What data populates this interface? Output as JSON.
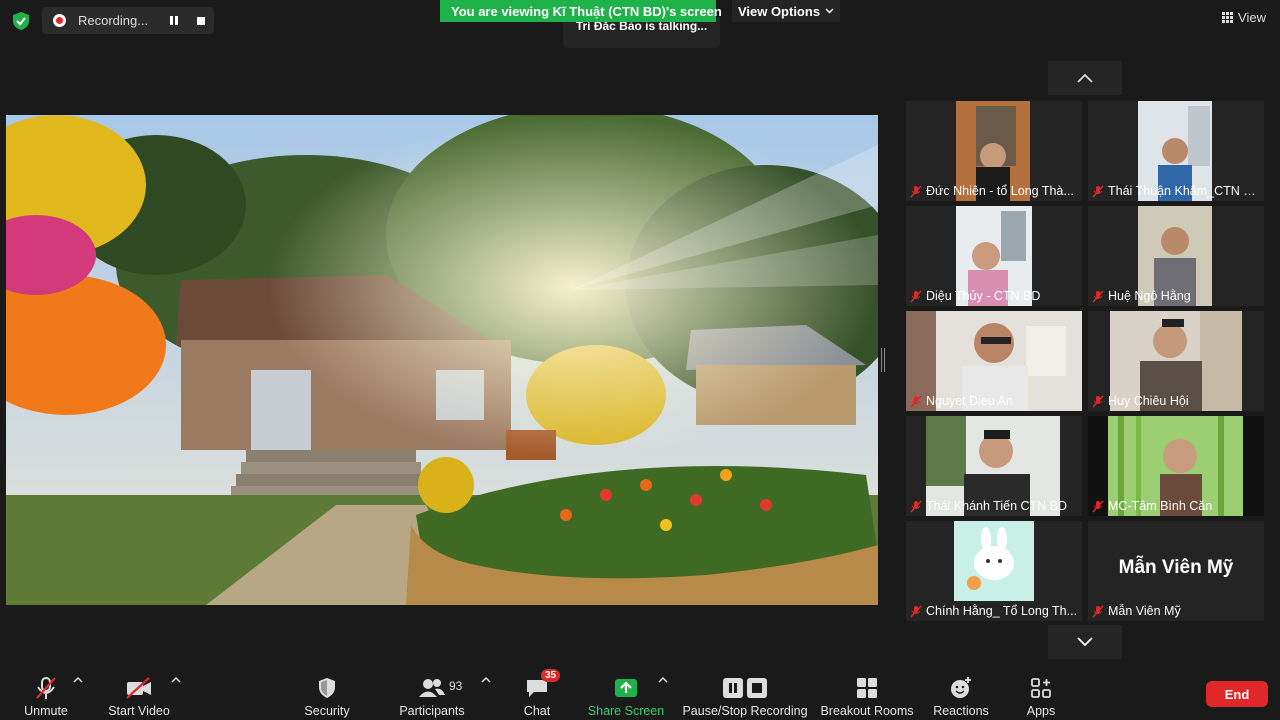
{
  "top": {
    "recording_label": "Recording...",
    "viewing_banner": "You are viewing Kĩ Thuật (CTN BD)'s screen",
    "view_options": "View Options",
    "talking": "Trí Đắc Bảo is talking...",
    "view_label": "View"
  },
  "gallery": {
    "tiles": [
      {
        "name": "Đức Nhiên - tổ Long Thà..."
      },
      {
        "name": "Thái Thuận Khâm_CTN Bỉ..."
      },
      {
        "name": "Diệu Thủy - CTN BD"
      },
      {
        "name": "Huệ Ngô Hằng"
      },
      {
        "name": "Nguyet Dieu An"
      },
      {
        "name": "Huy Chiêu Hội"
      },
      {
        "name": "Thái Khánh Tiến CTN BD"
      },
      {
        "name": "MC-Tâm Bình Căn"
      },
      {
        "name": "Chính Hằng_ Tổ Long Th..."
      },
      {
        "name": "Mẫn Viên Mỹ",
        "display_text": "Mẫn Viên Mỹ"
      }
    ]
  },
  "toolbar": {
    "unmute": "Unmute",
    "start_video": "Start Video",
    "security": "Security",
    "participants": "Participants",
    "participants_count": "93",
    "chat": "Chat",
    "chat_badge": "35",
    "share_screen": "Share Screen",
    "pause_stop_recording": "Pause/Stop Recording",
    "breakout_rooms": "Breakout Rooms",
    "reactions": "Reactions",
    "apps": "Apps",
    "end": "End"
  },
  "colors": {
    "green": "#1fb24a",
    "red": "#e02828",
    "background": "#1a1a1a"
  }
}
